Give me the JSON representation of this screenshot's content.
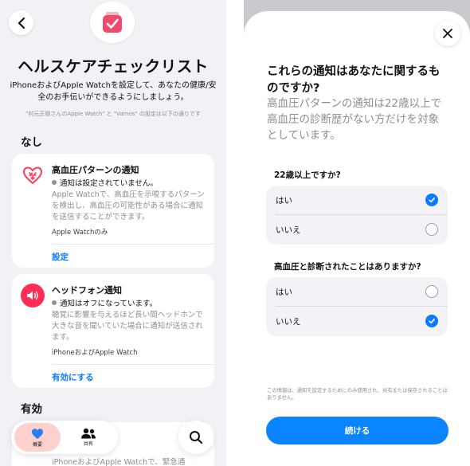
{
  "left": {
    "title": "ヘルスケアチェックリスト",
    "description": "iPhoneおよびApple Watchを設定して、あなたの健康/安全のお手伝いができるようにしましょう。",
    "settings_note": "\"村元正剛さんのApple Watch\" と \"Vamos\" の設定は以下の通りです",
    "section_none": "なし",
    "section_active": "有効",
    "cards": [
      {
        "title": "高血圧パターンの通知",
        "icon": "heart-arrows-icon",
        "status": "通知は設定されていません。",
        "body": "Apple Watchで、高血圧を示唆するパターンを検出し、高血圧の可能性がある場合に通知を送信することができます。",
        "device": "Apple Watchのみ",
        "action": "設定"
      },
      {
        "title": "ヘッドフォン通知",
        "icon": "speaker-icon",
        "status": "通知はオフになっています。",
        "body": "聴覚に影響を与えるほど長い間ヘッドホンで大きな音を聞いていた場合に通知が送信されます。",
        "device": "iPhoneおよびApple Watch",
        "action": "有効にする"
      },
      {
        "body": "iPhoneおよびApple Watchで、緊急通"
      }
    ],
    "tabs": [
      {
        "label": "概要",
        "icon": "heart-icon"
      },
      {
        "label": "共有",
        "icon": "people-icon"
      }
    ]
  },
  "right": {
    "title": "これらの通知はあなたに関するものですか?",
    "subtitle": "高血圧パターンの通知は22歳以上で高血圧の診断歴がない方だけを対象としています。",
    "questions": [
      {
        "label": "22歳以上ですか?",
        "options": [
          {
            "label": "はい",
            "selected": true
          },
          {
            "label": "いいえ",
            "selected": false
          }
        ]
      },
      {
        "label": "高血圧と診断されたことはありますか?",
        "options": [
          {
            "label": "はい",
            "selected": false
          },
          {
            "label": "いいえ",
            "selected": true
          }
        ]
      }
    ],
    "footnote": "この情報は、通知を設定するためにのみ使用され、共有または保存されることはありません。",
    "continue_label": "続ける"
  },
  "colors": {
    "accent_blue": "#0a7aff",
    "heart_pink": "#ff3b5c",
    "headphone_red": "#ff2d55"
  }
}
